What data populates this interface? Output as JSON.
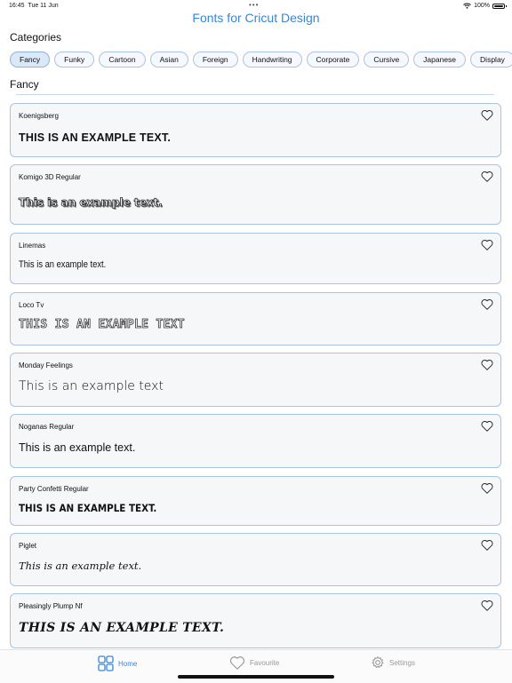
{
  "status": {
    "time": "16:45",
    "date": "Tue 11 Jun",
    "battery": "100%"
  },
  "nav": {
    "title": "Fonts for Cricut Design"
  },
  "categories_title": "Categories",
  "categories": [
    "Fancy",
    "Funky",
    "Cartoon",
    "Asian",
    "Foreign",
    "Handwriting",
    "Corporate",
    "Cursive",
    "Japanese",
    "Display"
  ],
  "selected_category": "Fancy",
  "subheading": "Fancy",
  "fonts": [
    {
      "name": "Koenigsberg",
      "sample": "THIS IS AN EXAMPLE TEXT."
    },
    {
      "name": "Komigo 3D Regular",
      "sample": "This is an example text."
    },
    {
      "name": "Linemas",
      "sample": "This is an example text."
    },
    {
      "name": "Loco Tv",
      "sample": "THIS IS AN EXAMPLE TEXT"
    },
    {
      "name": "Monday Feelings",
      "sample": "This is an example text"
    },
    {
      "name": "Noganas Regular",
      "sample": "This is an example text."
    },
    {
      "name": "Party Confetti Regular",
      "sample": "THIS IS AN EXAMPLE TEXT."
    },
    {
      "name": "Piglet",
      "sample": "This is an example text."
    },
    {
      "name": "Pleasingly Plump Nf",
      "sample": "THIS IS AN EXAMPLE TEXT."
    }
  ],
  "tabs": {
    "home": "Home",
    "favourite": "Favourite",
    "settings": "Settings"
  },
  "colors": {
    "accent": "#3a86d6",
    "card_border": "#a9c3e2",
    "card_bg": "#f6f7f9"
  }
}
